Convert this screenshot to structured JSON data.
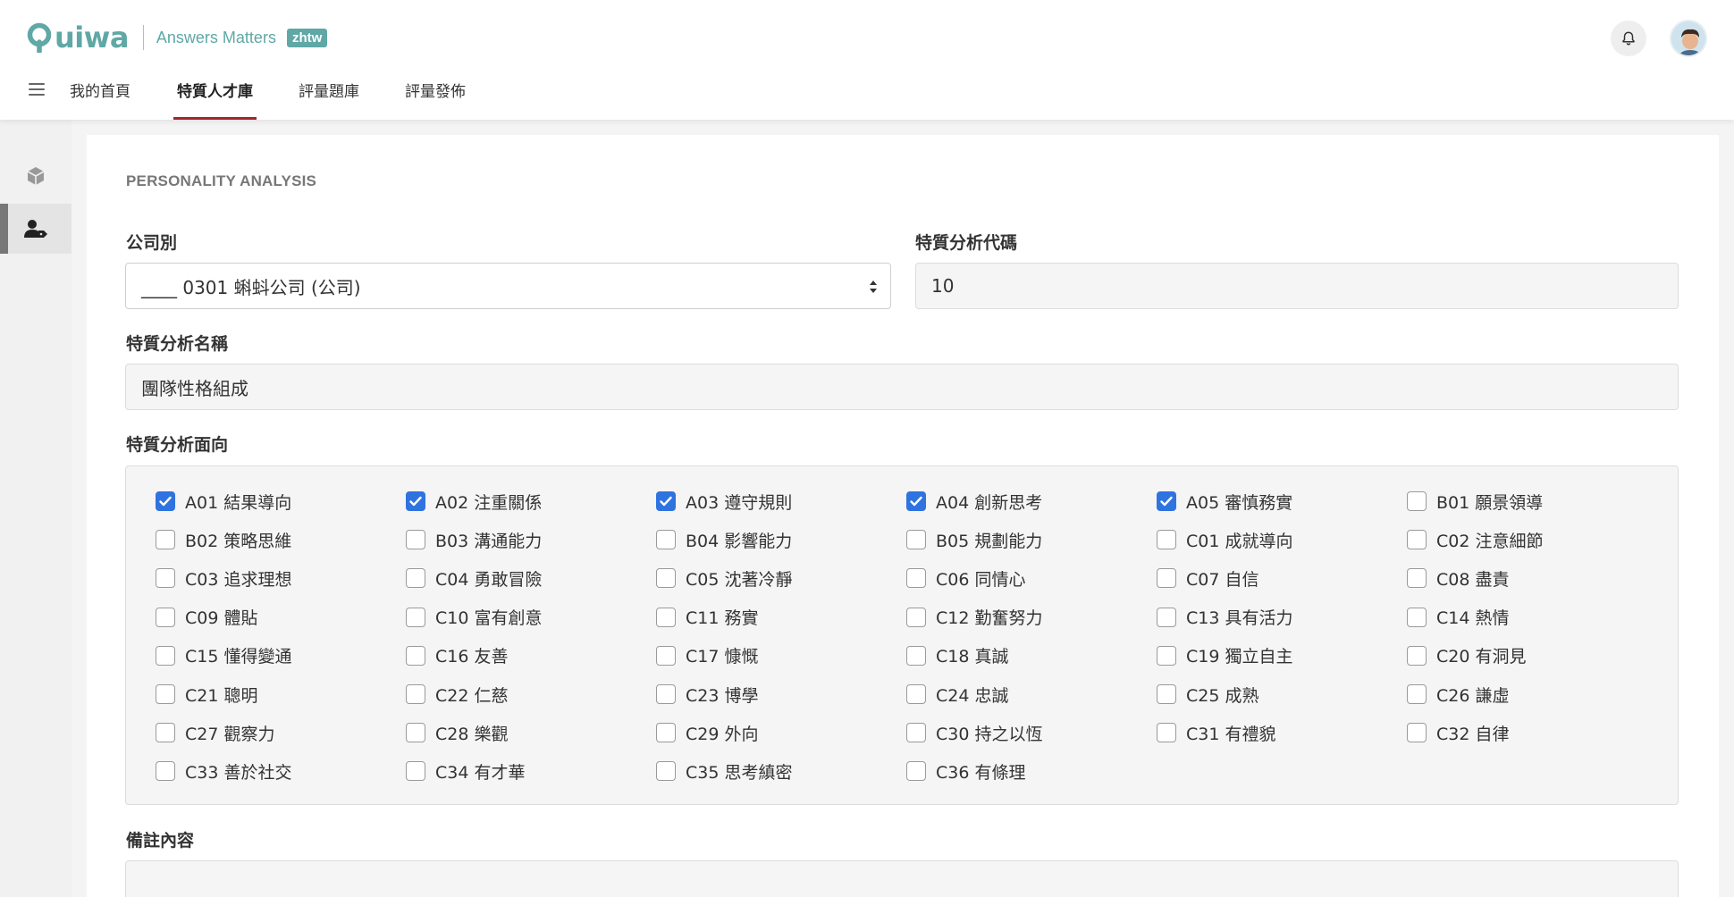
{
  "header": {
    "logo_text": "uiwa",
    "tagline": "Answers Matters",
    "lang_badge": "zhtw",
    "colors": {
      "brand": "#5fa8a6",
      "active_tab": "#a7252c",
      "checkbox": "#2f73e0"
    }
  },
  "nav": {
    "tabs": [
      {
        "label": "我的首頁",
        "active": false
      },
      {
        "label": "特質人才庫",
        "active": true
      },
      {
        "label": "評量題庫",
        "active": false
      },
      {
        "label": "評量發佈",
        "active": false
      }
    ]
  },
  "sidebar": {
    "items": [
      {
        "icon": "package-icon",
        "active": false
      },
      {
        "icon": "user-tag-icon",
        "active": true
      }
    ]
  },
  "form": {
    "section_title": "PERSONALITY ANALYSIS",
    "company_label": "公司別",
    "company_value": "____ 0301 蝌蚪公司 (公司)",
    "code_label": "特質分析代碼",
    "code_value": "10",
    "name_label": "特質分析名稱",
    "name_value": "團隊性格組成",
    "aspects_label": "特質分析面向",
    "notes_label": "備註內容",
    "notes_value": ""
  },
  "aspects": [
    {
      "label": "A01 結果導向",
      "checked": true
    },
    {
      "label": "A02 注重關係",
      "checked": true
    },
    {
      "label": "A03 遵守規則",
      "checked": true
    },
    {
      "label": "A04 創新思考",
      "checked": true
    },
    {
      "label": "A05 審慎務實",
      "checked": true
    },
    {
      "label": "B01 願景領導",
      "checked": false
    },
    {
      "label": "B02 策略思維",
      "checked": false
    },
    {
      "label": "B03 溝通能力",
      "checked": false
    },
    {
      "label": "B04 影響能力",
      "checked": false
    },
    {
      "label": "B05 規劃能力",
      "checked": false
    },
    {
      "label": "C01 成就導向",
      "checked": false
    },
    {
      "label": "C02 注意細節",
      "checked": false
    },
    {
      "label": "C03 追求理想",
      "checked": false
    },
    {
      "label": "C04 勇敢冒險",
      "checked": false
    },
    {
      "label": "C05 沈著冷靜",
      "checked": false
    },
    {
      "label": "C06 同情心",
      "checked": false
    },
    {
      "label": "C07 自信",
      "checked": false
    },
    {
      "label": "C08 盡責",
      "checked": false
    },
    {
      "label": "C09 體貼",
      "checked": false
    },
    {
      "label": "C10 富有創意",
      "checked": false
    },
    {
      "label": "C11 務實",
      "checked": false
    },
    {
      "label": "C12 勤奮努力",
      "checked": false
    },
    {
      "label": "C13 具有活力",
      "checked": false
    },
    {
      "label": "C14 熱情",
      "checked": false
    },
    {
      "label": "C15 懂得變通",
      "checked": false
    },
    {
      "label": "C16 友善",
      "checked": false
    },
    {
      "label": "C17 慷慨",
      "checked": false
    },
    {
      "label": "C18 真誠",
      "checked": false
    },
    {
      "label": "C19 獨立自主",
      "checked": false
    },
    {
      "label": "C20 有洞見",
      "checked": false
    },
    {
      "label": "C21 聰明",
      "checked": false
    },
    {
      "label": "C22 仁慈",
      "checked": false
    },
    {
      "label": "C23 博學",
      "checked": false
    },
    {
      "label": "C24 忠誠",
      "checked": false
    },
    {
      "label": "C25 成熟",
      "checked": false
    },
    {
      "label": "C26 謙虛",
      "checked": false
    },
    {
      "label": "C27 觀察力",
      "checked": false
    },
    {
      "label": "C28 樂觀",
      "checked": false
    },
    {
      "label": "C29 外向",
      "checked": false
    },
    {
      "label": "C30 持之以恆",
      "checked": false
    },
    {
      "label": "C31 有禮貌",
      "checked": false
    },
    {
      "label": "C32 自律",
      "checked": false
    },
    {
      "label": "C33 善於社交",
      "checked": false
    },
    {
      "label": "C34 有才華",
      "checked": false
    },
    {
      "label": "C35 思考縝密",
      "checked": false
    },
    {
      "label": "C36 有條理",
      "checked": false
    }
  ]
}
